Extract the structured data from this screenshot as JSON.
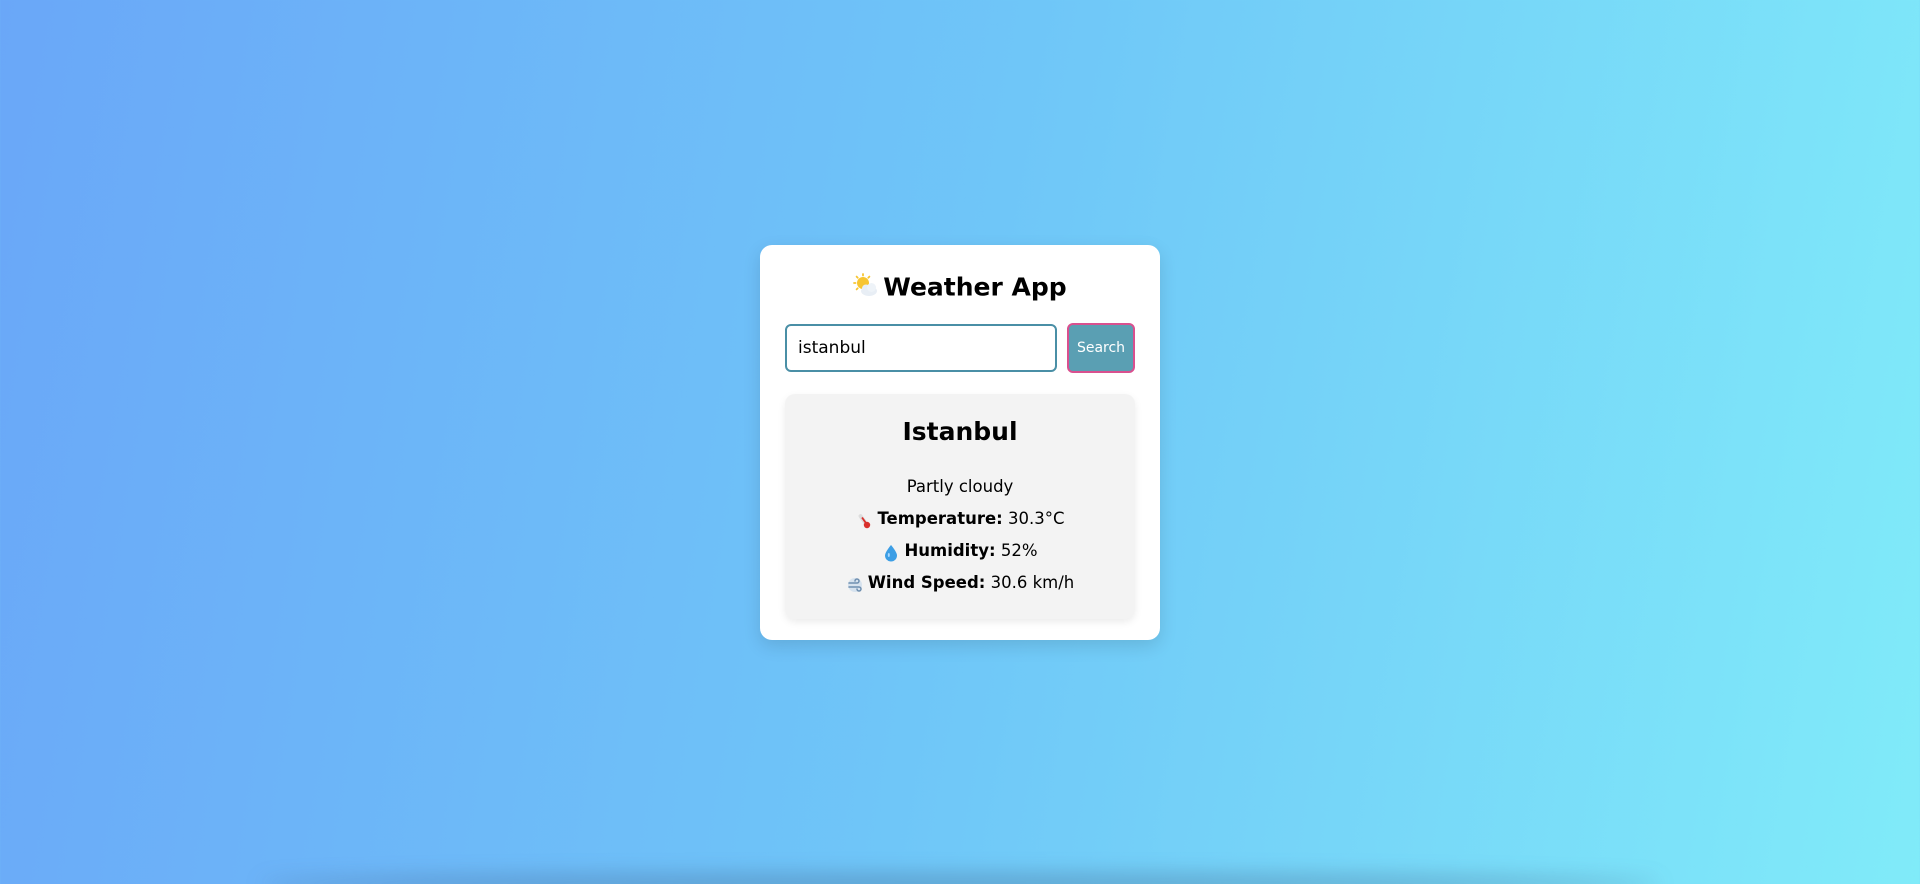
{
  "app": {
    "title": "Weather App",
    "title_icon": "sun-behind-cloud-icon"
  },
  "search": {
    "value": "istanbul",
    "button_label": "Search"
  },
  "result": {
    "city": "Istanbul",
    "condition": "Partly cloudy",
    "temperature": {
      "icon": "thermometer-icon",
      "label": "Temperature:",
      "value": "30.3°C"
    },
    "humidity": {
      "icon": "droplet-icon",
      "label": "Humidity:",
      "value": "52%"
    },
    "wind": {
      "icon": "wind-icon",
      "label": "Wind Speed:",
      "value": "30.6 km/h"
    }
  },
  "colors": {
    "background_start": "#6aa7f8",
    "background_end": "#80ebf9",
    "button_background": "#5a9fb3",
    "button_border": "#d9508f",
    "input_border": "#4a8fa6",
    "result_background": "#f3f3f3"
  }
}
